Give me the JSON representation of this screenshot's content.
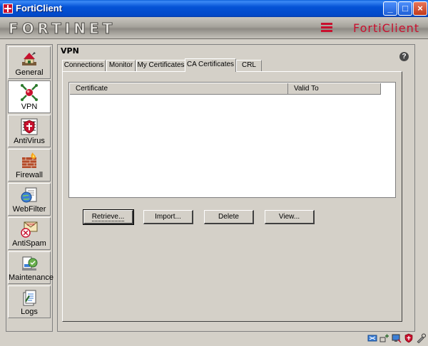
{
  "window": {
    "title": "FortiClient",
    "minimize_glyph": "_",
    "maximize_glyph": "□",
    "close_glyph": "×"
  },
  "banner": {
    "left_logo": "FORTINET",
    "right_logo": "FortiClient"
  },
  "sidebar": {
    "items": [
      {
        "label": "General",
        "icon": "home-icon"
      },
      {
        "label": "VPN",
        "icon": "vpn-icon",
        "active": true
      },
      {
        "label": "AntiVirus",
        "icon": "antivirus-icon"
      },
      {
        "label": "Firewall",
        "icon": "firewall-icon"
      },
      {
        "label": "WebFilter",
        "icon": "webfilter-icon"
      },
      {
        "label": "AntiSpam",
        "icon": "antispam-icon"
      },
      {
        "label": "Maintenance",
        "icon": "maintenance-icon"
      },
      {
        "label": "Logs",
        "icon": "logs-icon"
      }
    ]
  },
  "main": {
    "section_title": "VPN",
    "help_glyph": "?",
    "tabs": [
      {
        "label": "Connections"
      },
      {
        "label": "Monitor"
      },
      {
        "label": "My Certificates"
      },
      {
        "label": "CA Certificates",
        "active": true
      },
      {
        "label": "CRL"
      }
    ],
    "table": {
      "columns": [
        "Certificate",
        "Valid To"
      ],
      "rows": []
    },
    "buttons": {
      "retrieve": "Retrieve...",
      "import": "Import...",
      "delete": "Delete",
      "view": "View..."
    }
  },
  "colors": {
    "titlebar": "#0553d6",
    "brand_red": "#c8102e",
    "window_bg": "#d4d0c8"
  }
}
